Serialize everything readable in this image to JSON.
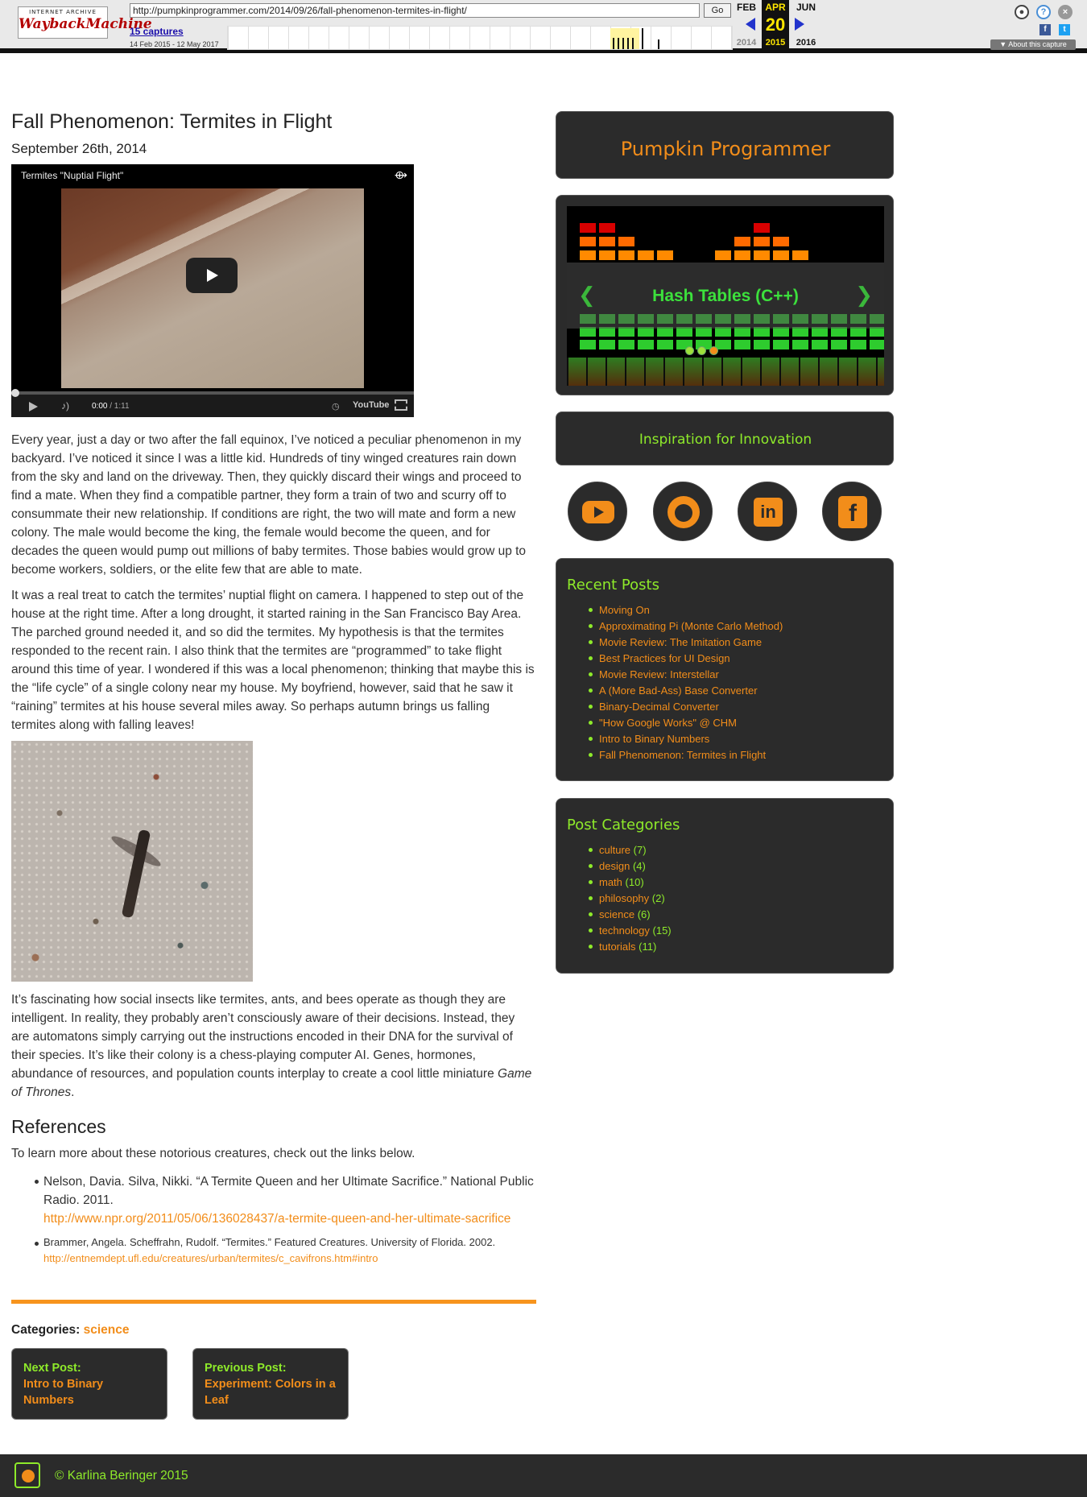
{
  "wayback": {
    "logo_line1": "INTERNET ARCHIVE",
    "logo_line2": "WaybackMachine",
    "url": "http://pumpkinprogrammer.com/2014/09/26/fall-phenomenon-termites-in-flight/",
    "go_label": "Go",
    "captures": "15 captures",
    "date_range": "14 Feb 2015 - 12 May 2017",
    "months": {
      "prev": "FEB",
      "current": "APR",
      "next": "JUN"
    },
    "day": "20",
    "years": {
      "prev": "2014",
      "current": "2015",
      "next": "2016"
    },
    "about": "About this capture",
    "icons": [
      "user-icon",
      "help-icon",
      "close-icon",
      "facebook-icon",
      "twitter-icon"
    ]
  },
  "post": {
    "title": "Fall Phenomenon: Termites in Flight",
    "date": "September 26th, 2014",
    "video": {
      "title": "Termites \"Nuptial Flight\"",
      "time": "0:00",
      "duration": " / 1:11",
      "brand": "YouTube"
    },
    "paragraphs": [
      "Every year, just a day or two after the fall equinox, I’ve noticed a peculiar phenomenon in my backyard. I’ve noticed it since I was a little kid. Hundreds of tiny winged creatures rain down from the sky and land on the driveway. Then, they quickly discard their wings and proceed to find a mate. When they find a compatible partner, they form a train of two and scurry off to consummate their new relationship. If conditions are right, the two will mate and form a new colony. The male would become the king, the female would become the queen, and for decades the queen would pump out millions of baby termites. Those babies would grow up to become workers, soldiers, or the elite few that are able to mate.",
      "It was a real treat to catch the termites’ nuptial flight on camera. I happened to step out of the house at the right time. After a long drought, it started raining in the San Francisco Bay Area. The parched ground needed it, and so did the termites. My hypothesis is that the termites responded to the recent rain. I also think that the termites are “programmed” to take flight around this time of year. I wondered if this was a local phenomenon; thinking that maybe this is the “life cycle” of a single colony near my house. My boyfriend, however, said that he saw it “raining” termites at his house several miles away. So perhaps autumn brings us falling termites along with falling leaves!",
      "It’s fascinating how social insects like termites, ants, and bees operate as though they are intelligent. In reality, they probably aren’t consciously aware of their decisions. Instead, they are automatons simply carrying out the instructions encoded in their DNA for the survival of their species. It’s like their colony is a chess-playing computer AI. Genes, hormones, abundance of resources, and population counts interplay to create a cool little miniature "
    ],
    "paragraph3_em": "Game of Thrones",
    "paragraph3_end": ".",
    "references_heading": "References",
    "references_intro": "To learn more about these notorious creatures, check out the links below.",
    "references": [
      {
        "text": "Nelson, Davia. Silva, Nikki. “A Termite Queen and her Ultimate Sacrifice.” National Public Radio. 2011.",
        "link": "http://www.npr.org/2011/05/06/136028437/a-termite-queen-and-her-ultimate-sacrifice"
      },
      {
        "text": "Brammer, Angela. Scheffrahn, Rudolf. “Termites.” Featured Creatures. University of Florida. 2002.",
        "link": "http://entnemdept.ufl.edu/creatures/urban/termites/c_cavifrons.htm#intro"
      }
    ],
    "categories_label": "Categories:",
    "category": "science",
    "next_post": {
      "label": "Next Post:",
      "title": "Intro to Binary Numbers"
    },
    "previous_post": {
      "label": "Previous Post:",
      "title": "Experiment: Colors in a Leaf"
    }
  },
  "sidebar": {
    "site_title": "Pumpkin Programmer",
    "slider": {
      "slide_title": "Hash Tables (C++)",
      "slide_count": 3,
      "active_slide": 3
    },
    "tagline": "Inspiration for Innovation",
    "social": [
      "youtube-icon",
      "github-icon",
      "linkedin-icon",
      "facebook-icon"
    ],
    "social_labels": {
      "linkedin": "in",
      "facebook": "f"
    },
    "recent_heading": "Recent Posts",
    "recent_posts": [
      "Moving On",
      "Approximating Pi (Monte Carlo Method)",
      "Movie Review: The Imitation Game",
      "Best Practices for UI Design",
      "Movie Review: Interstellar",
      "A (More Bad-Ass) Base Converter",
      "Binary-Decimal Converter",
      "\"How Google Works\" @ CHM",
      "Intro to Binary Numbers",
      "Fall Phenomenon: Termites in Flight"
    ],
    "categories_heading": "Post Categories",
    "categories": [
      {
        "name": "culture",
        "count": "(7)"
      },
      {
        "name": "design",
        "count": "(4)"
      },
      {
        "name": "math",
        "count": "(10)"
      },
      {
        "name": "philosophy",
        "count": "(2)"
      },
      {
        "name": "science",
        "count": "(6)"
      },
      {
        "name": "technology",
        "count": "(15)"
      },
      {
        "name": "tutorials",
        "count": "(11)"
      }
    ]
  },
  "footer": {
    "copyright": "© Karlina Beringer 2015"
  },
  "colors": {
    "accent_orange": "#f28d1a",
    "accent_green": "#8eea2a",
    "panel": "#2b2b2b",
    "divider": "#f7941d"
  }
}
